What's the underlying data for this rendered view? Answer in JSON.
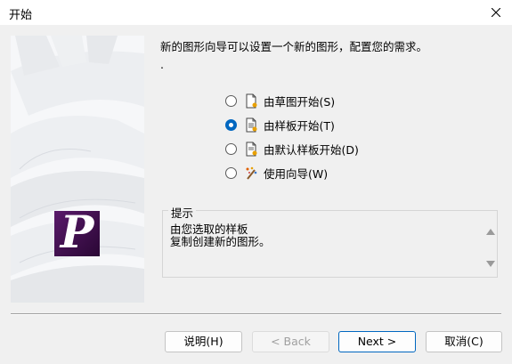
{
  "window": {
    "title": "开始"
  },
  "intro": {
    "text": "新的图形向导可以设置一个新的图形，配置您的需求。",
    "dot": "."
  },
  "options": [
    {
      "label": "由草图开始(S)",
      "selected": false,
      "icon": "blank-document-icon"
    },
    {
      "label": "由样板开始(T)",
      "selected": true,
      "icon": "template-document-icon"
    },
    {
      "label": "由默认样板开始(D)",
      "selected": false,
      "icon": "default-template-icon"
    },
    {
      "label": "使用向导(W)",
      "selected": false,
      "icon": "wizard-wand-icon"
    }
  ],
  "hint": {
    "legend": "提示",
    "line1": "由您选取的样板",
    "line2": "复制创建新的图形。"
  },
  "buttons": {
    "help": "说明(H)",
    "back": "< Back",
    "next": "Next >",
    "cancel": "取消(C)"
  },
  "colors": {
    "accent": "#0067c0",
    "logo": "#4a1358"
  }
}
